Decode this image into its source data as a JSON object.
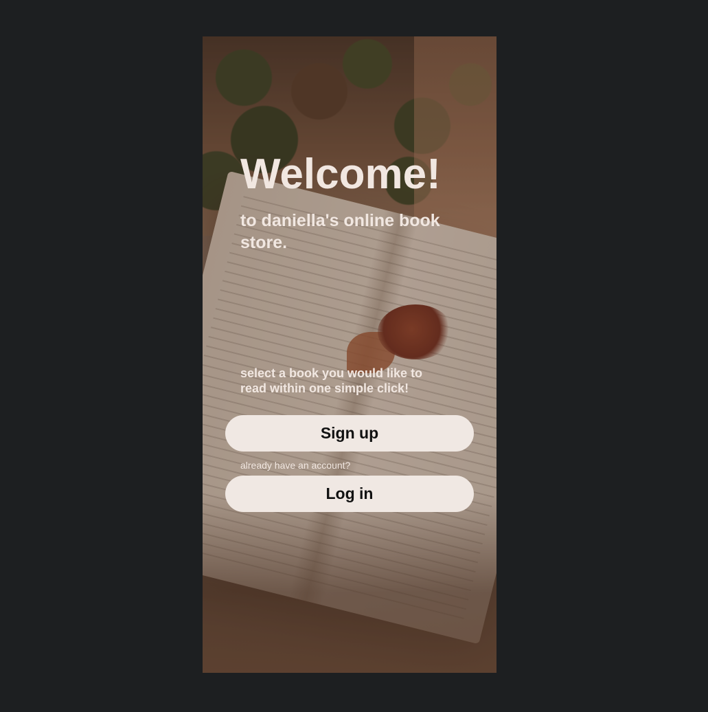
{
  "welcome": {
    "title": "Welcome!",
    "subtitle": "to daniella's online book store.",
    "tagline": "select a book you would like to read within one simple click!",
    "signup_label": "Sign up",
    "account_hint": "already have an account?",
    "login_label": "Log in"
  },
  "colors": {
    "page_background": "#1d1f21",
    "text": "#f1e7e1",
    "button_background": "#f0e8e3",
    "button_text": "#111111"
  }
}
